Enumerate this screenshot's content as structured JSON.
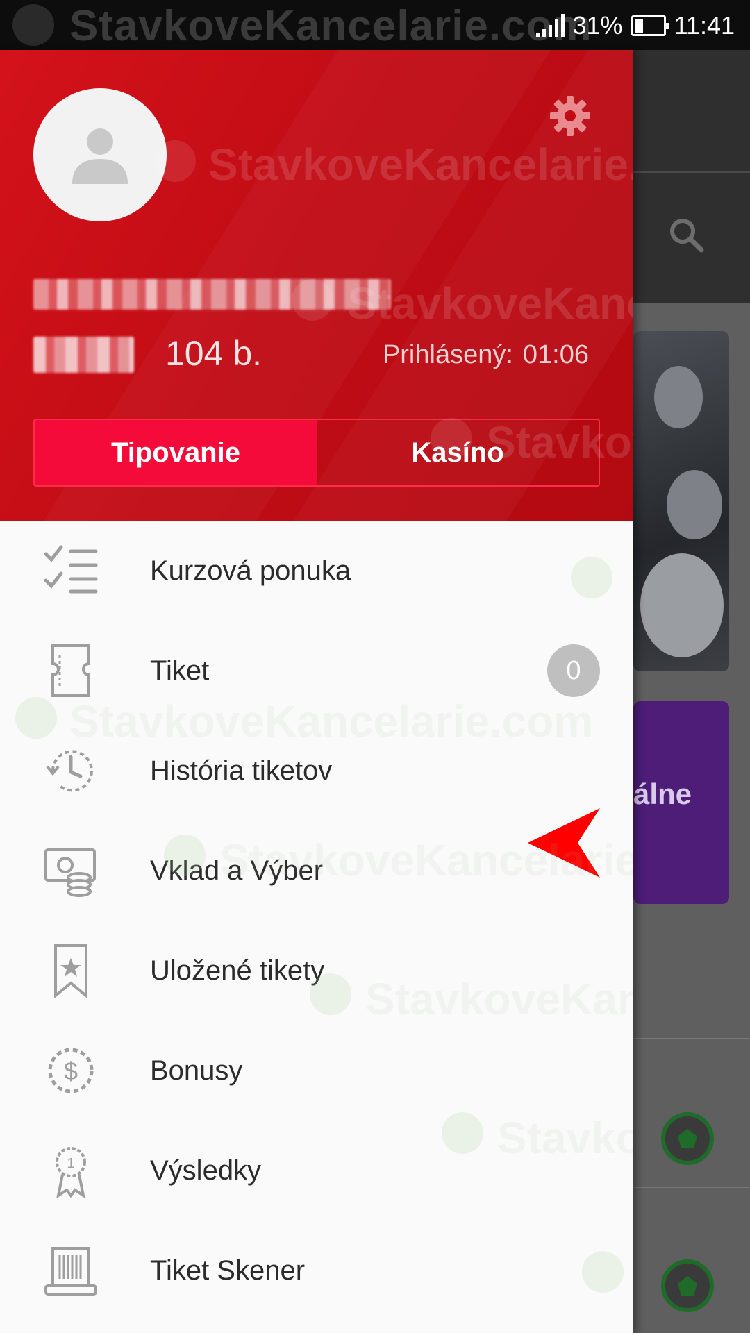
{
  "status_bar": {
    "signal_icon": "signal-icon",
    "battery_percent": "31%",
    "battery_level": 0.31,
    "battery_icon": "battery-icon",
    "time": "11:41",
    "watermark": "StavkoveKancelarie.com"
  },
  "drawer": {
    "header": {
      "avatar_icon": "user-avatar-icon",
      "settings_icon": "gear-icon",
      "points": "104 b.",
      "logged_in_label": "Prihlásený:",
      "logged_in_time": "01:06",
      "tabs": [
        {
          "label": "Tipovanie",
          "active": true
        },
        {
          "label": "Kasíno",
          "active": false
        }
      ]
    },
    "menu": [
      {
        "label": "Kurzová ponuka",
        "icon": "checklist-icon"
      },
      {
        "label": "Tiket",
        "icon": "ticket-icon",
        "badge": "0"
      },
      {
        "label": "História tiketov",
        "icon": "history-clock-icon"
      },
      {
        "label": "Vklad a Výber",
        "icon": "money-coins-icon"
      },
      {
        "label": "Uložené tikety",
        "icon": "bookmark-star-icon"
      },
      {
        "label": "Bonusy",
        "icon": "bonus-dollar-icon"
      },
      {
        "label": "Výsledky",
        "icon": "medal-icon"
      },
      {
        "label": "Tiket Skener",
        "icon": "barcode-scanner-icon"
      }
    ]
  },
  "background": {
    "card_text": "álne",
    "search_icon": "search-icon",
    "ball_icon": "football-icon"
  },
  "colors": {
    "header_red": "#c10c15",
    "active_tab": "#f50b3a",
    "badge_gray": "#bfbfbf",
    "pointer_red": "#ff0000"
  }
}
